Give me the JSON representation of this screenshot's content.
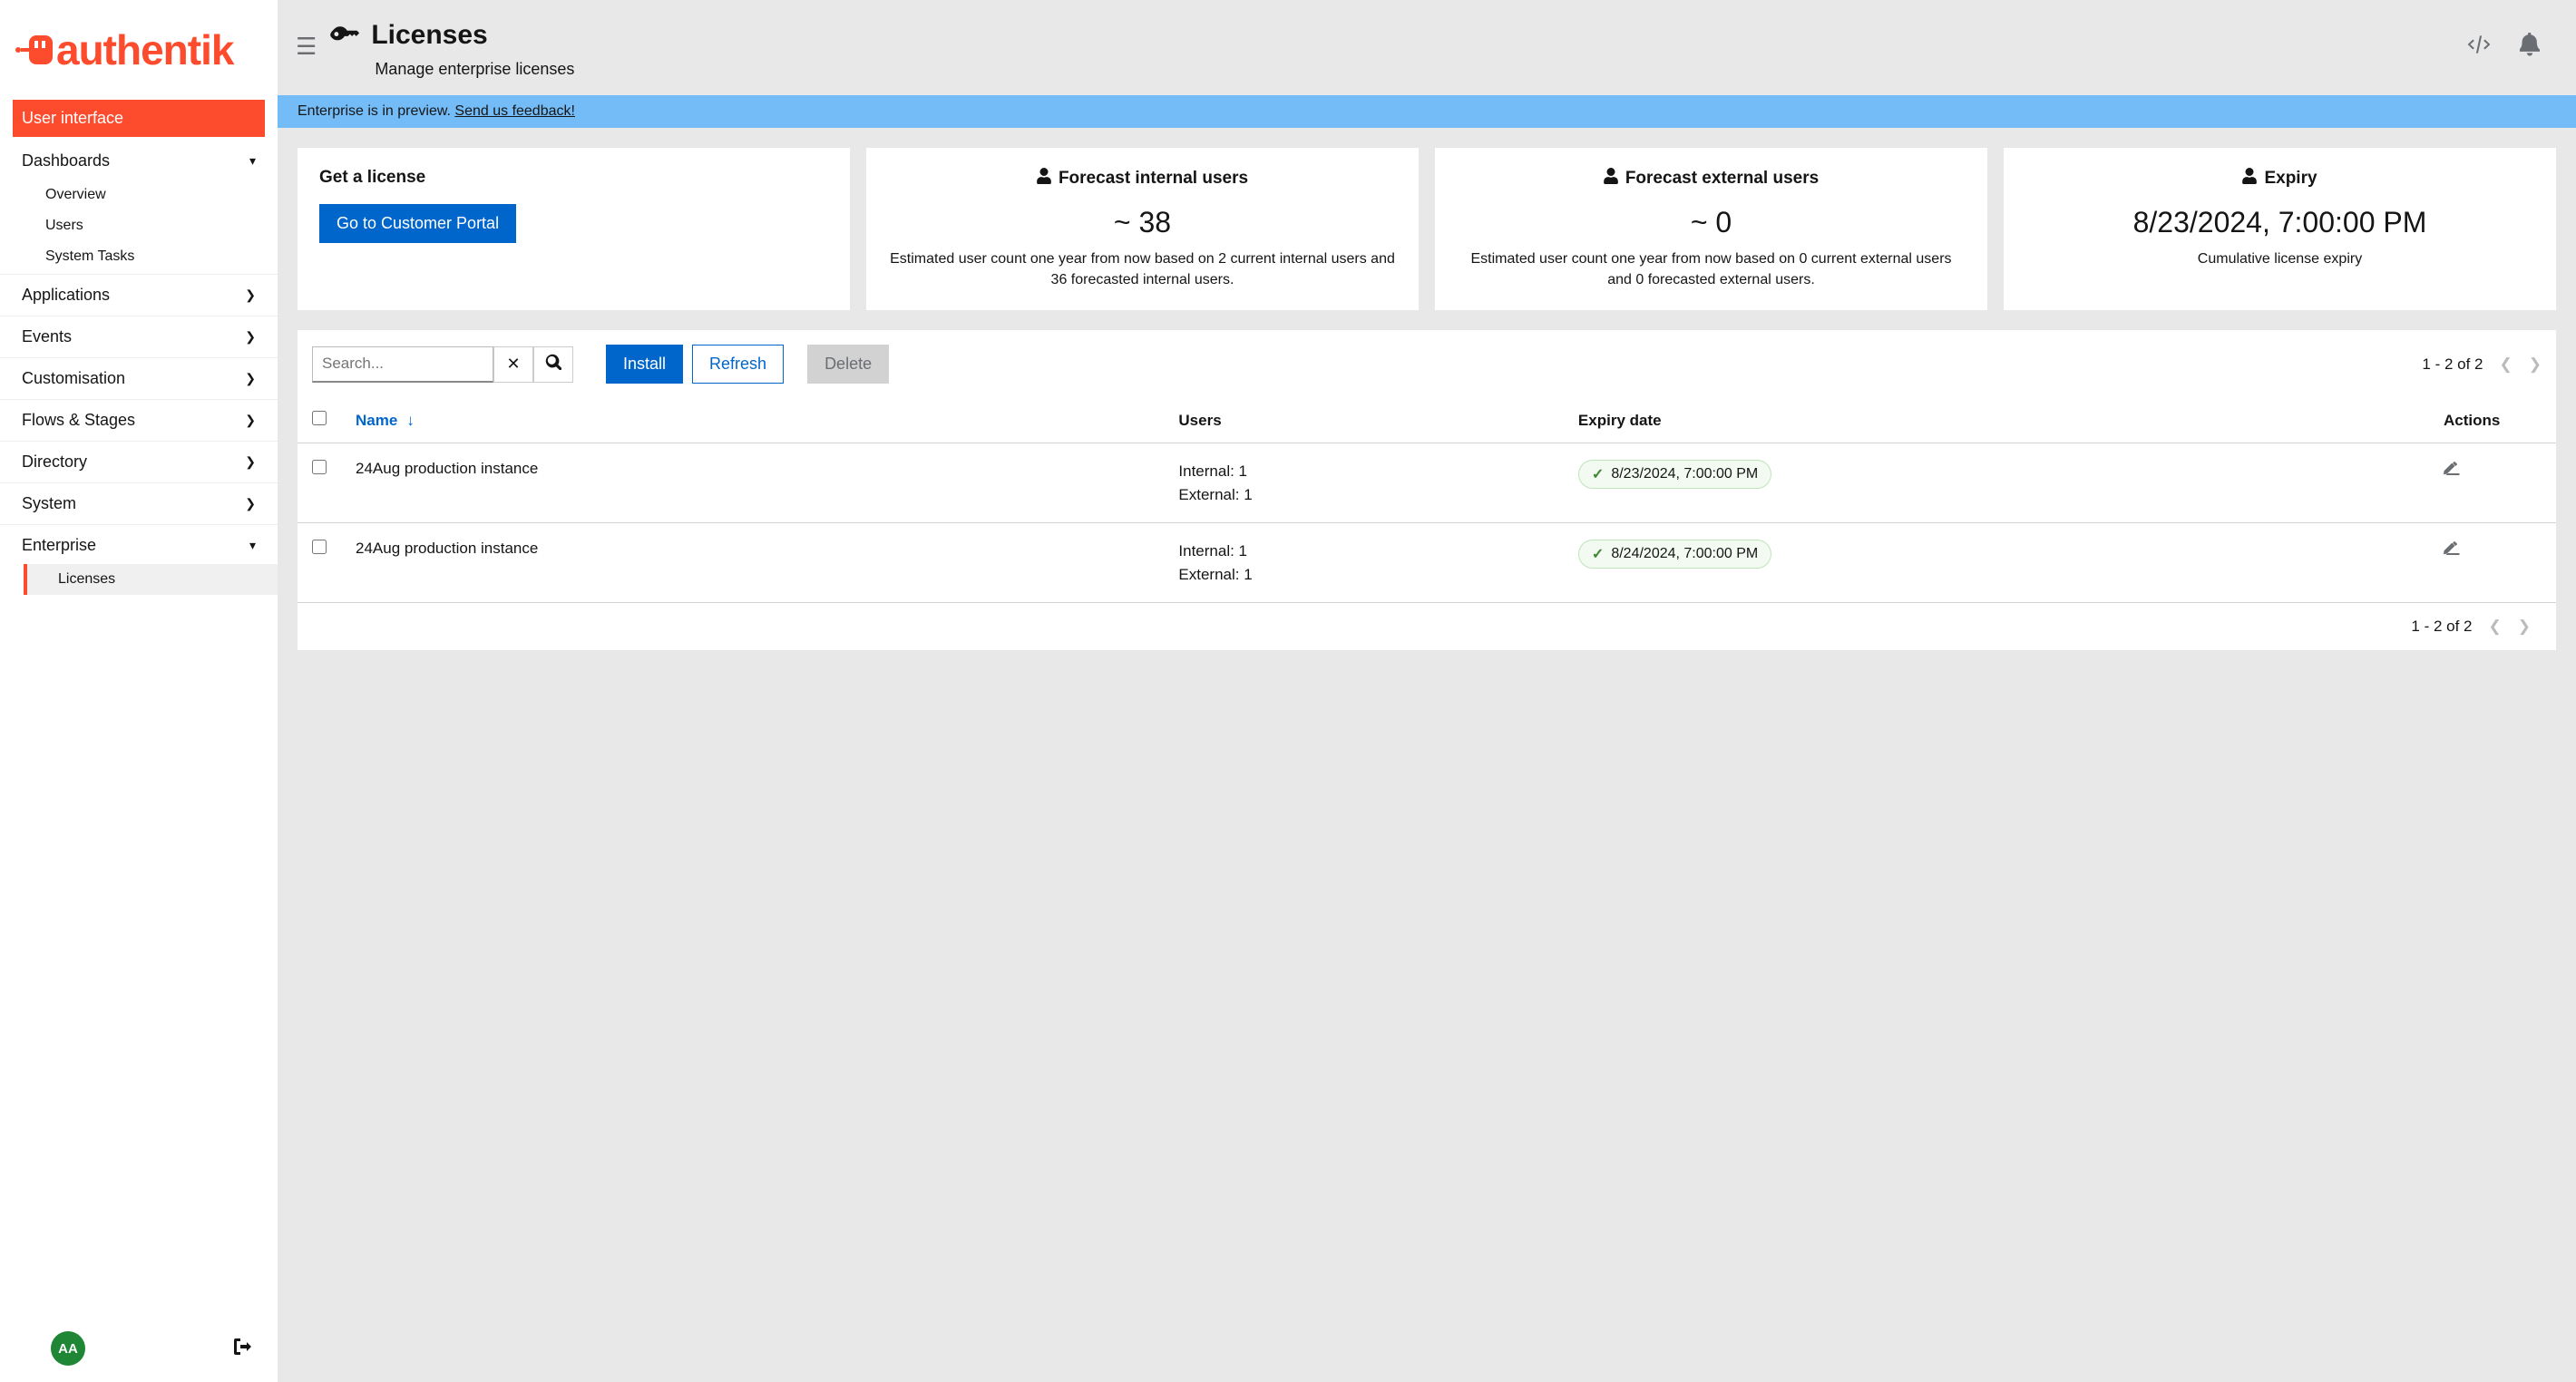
{
  "brand": "authentik",
  "sidebar": {
    "userInterface": "User interface",
    "dashboards": {
      "label": "Dashboards",
      "items": [
        "Overview",
        "Users",
        "System Tasks"
      ]
    },
    "items": [
      "Applications",
      "Events",
      "Customisation",
      "Flows & Stages",
      "Directory",
      "System"
    ],
    "enterprise": {
      "label": "Enterprise",
      "items": [
        "Licenses"
      ]
    }
  },
  "avatar": "AA",
  "page": {
    "title": "Licenses",
    "subtitle": "Manage enterprise licenses"
  },
  "banner": {
    "text": "Enterprise is in preview. ",
    "linkText": "Send us feedback!"
  },
  "cards": {
    "getLicense": {
      "title": "Get a license",
      "button": "Go to Customer Portal"
    },
    "internal": {
      "title": "Forecast internal users",
      "value": "~ 38",
      "desc": "Estimated user count one year from now based on 2 current internal users and 36 forecasted internal users."
    },
    "external": {
      "title": "Forecast external users",
      "value": "~ 0",
      "desc": "Estimated user count one year from now based on 0 current external users and 0 forecasted external users."
    },
    "expiry": {
      "title": "Expiry",
      "value": "8/23/2024, 7:00:00 PM",
      "desc": "Cumulative license expiry"
    }
  },
  "toolbar": {
    "searchPlaceholder": "Search...",
    "install": "Install",
    "refresh": "Refresh",
    "delete": "Delete",
    "pager": "1 - 2 of 2"
  },
  "table": {
    "columns": {
      "name": "Name",
      "users": "Users",
      "expiry": "Expiry date",
      "actions": "Actions"
    },
    "rows": [
      {
        "name": "24Aug production instance",
        "internal": "Internal: 1",
        "external": "External: 1",
        "expiry": "8/23/2024, 7:00:00 PM"
      },
      {
        "name": "24Aug production instance",
        "internal": "Internal: 1",
        "external": "External: 1",
        "expiry": "8/24/2024, 7:00:00 PM"
      }
    ]
  }
}
